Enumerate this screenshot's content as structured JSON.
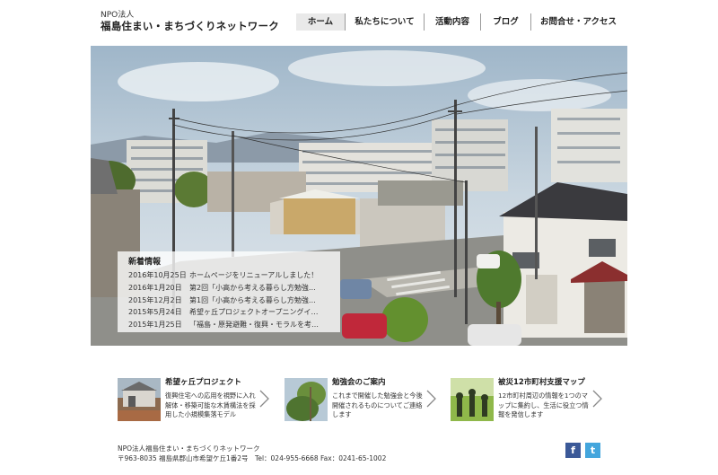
{
  "header": {
    "org_type": "NPO法人",
    "org_name": "福島住まい・まちづくりネットワーク"
  },
  "nav": {
    "items": [
      {
        "label": "ホーム",
        "active": true
      },
      {
        "label": "私たちについて",
        "active": false
      },
      {
        "label": "活動内容",
        "active": false
      },
      {
        "label": "ブログ",
        "active": false
      },
      {
        "label": "お問合せ・アクセス",
        "active": false
      }
    ]
  },
  "news": {
    "title": "新着情報",
    "items": [
      {
        "date": "2016年10月25日",
        "text": "ホームページをリニューアルしました！"
      },
      {
        "date": "2016年1月20日",
        "text": "第2回「小高から考える暮らし方勉強…"
      },
      {
        "date": "2015年12月2日",
        "text": "第1回「小高から考える暮らし方勉強…"
      },
      {
        "date": "2015年5月24日",
        "text": "希望ヶ丘プロジェクトオープニングイ…"
      },
      {
        "date": "2015年1月25日",
        "text": "「福島・原発避難・復興・モラルを考…"
      }
    ]
  },
  "cards": [
    {
      "title": "希望ヶ丘プロジェクト",
      "desc": "復興住宅への応用を視野に入れ解体・移築可能な木賃構法を採用した小規模集落モデル",
      "icon": "chevron-right-icon"
    },
    {
      "title": "勉強会のご案内",
      "desc": "これまで開催した勉強会と今後開催されるものについてご連絡します",
      "icon": "chevron-right-icon"
    },
    {
      "title": "被災12市町村支援マップ",
      "desc": "12市町村周辺の情報を1つのマップに集約し、生活に役立つ情報を発信します",
      "icon": "chevron-right-icon"
    }
  ],
  "footer": {
    "name": "NPO法人福島住まい・まちづくりネットワーク",
    "address": "〒963-8035 福島県郡山市希望ケ丘1番2号　Tel：024-955-6668 Fax：0241-65-1002"
  },
  "social": {
    "facebook_glyph": "f",
    "twitter_glyph": "t",
    "facebook_color": "#3b5998",
    "twitter_color": "#44a6dd"
  }
}
